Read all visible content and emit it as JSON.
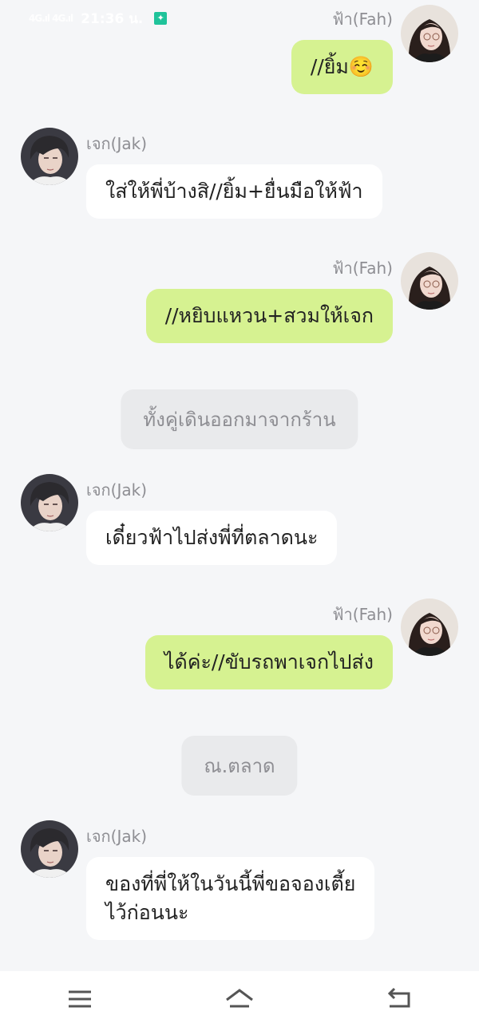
{
  "status": {
    "time": "21:36 น.",
    "signal": "4G.ıl 4G.ıl"
  },
  "characters": {
    "fah": "ฟ้า(Fah)",
    "jak": "เจก(Jak)"
  },
  "messages": [
    {
      "text": "//ยิ้ม☺️"
    },
    {
      "text": "ใส่ให้พี่บ้างสิ//ยิ้ม+ยื่นมือให้ฟ้า"
    },
    {
      "text": "//หยิบแหวน+สวมให้เจก"
    },
    {
      "text": "ทั้งคู่เดินออกมาจากร้าน"
    },
    {
      "text": "เดี๋ยวฟ้าไปส่งพี่ที่ตลาดนะ"
    },
    {
      "text": "ได้ค่ะ//ขับรถพาเจกไปส่ง"
    },
    {
      "text": "ณ.ตลาด"
    },
    {
      "line1": "ของที่พี่ให้ในวันนี้พี่ขอจองเตี้ย",
      "line2": "ไว้ก่อนนะ"
    }
  ],
  "nav": {
    "icons": [
      "menu-icon",
      "home-icon",
      "back-icon"
    ]
  }
}
